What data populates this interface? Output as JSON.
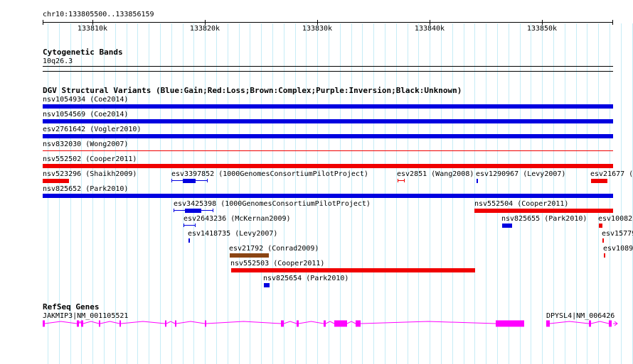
{
  "ruler": {
    "location": "chr10:133805500..133856159",
    "ticks": [
      "133810k",
      "133820k",
      "133830k",
      "133840k",
      "133850k"
    ]
  },
  "cytoband": {
    "title": "Cytogenetic Bands",
    "band": "10q26.3"
  },
  "dgv": {
    "title": "DGV Structural Variants (Blue:Gain;Red:Loss;Brown:Complex;Purple:Inversion;Black:Unknown)",
    "colors": {
      "gain": "#0000e0",
      "loss": "#f00000",
      "complex": "#8b4513"
    },
    "variants": {
      "v1": "nsv1054934 (Coe2014)",
      "v2": "nsv1054569 (Coe2014)",
      "v3": "esv2761642 (Vogler2010)",
      "v4": "nsv832030 (Wong2007)",
      "v5": "nsv552502 (Cooper2011)",
      "v6": "nsv523296 (Shaikh2009)",
      "v7": "esv3397852 (1000GenomesConsortiumPilotProject)",
      "v8": "esv2851 (Wang2008)",
      "v9": "esv1290967 (Levy2007)",
      "v10": "esv21677 (",
      "v11": "nsv825652 (Park2010)",
      "v12": "esv3425398 (1000GenomesConsortiumPilotProject)",
      "v13": "nsv552504 (Cooper2011)",
      "v14": "esv2643236 (McKernan2009)",
      "v15": "nsv825655 (Park2010)",
      "v16": "esv10082",
      "v17": "esv1418735 (Levy2007)",
      "v18": "esv15779",
      "v19": "esv21792 (Conrad2009)",
      "v20": "esv1089",
      "v21": "nsv552503 (Cooper2011)",
      "v22": "nsv825654 (Park2010)"
    }
  },
  "refseq": {
    "title": "RefSeq Genes",
    "gene1": "JAKMIP3|NM_001105521",
    "gene2": "DPYSL4|NM_006426",
    "color": "#ff00ff"
  }
}
